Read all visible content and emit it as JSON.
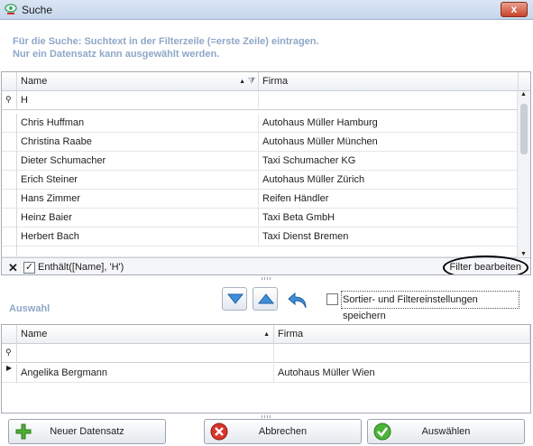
{
  "window": {
    "title": "Suche",
    "close_label": "x"
  },
  "hint": {
    "line1": "Für die Suche: Suchtext in der Filterzeile (=erste Zeile) eintragen.",
    "line2": "Nur ein Datensatz kann ausgewählt werden."
  },
  "grid1": {
    "columns": [
      "Name",
      "Firma"
    ],
    "filter_value": "H",
    "rows": [
      {
        "name": "Chris Huffman",
        "firma": "Autohaus Müller Hamburg"
      },
      {
        "name": "Christina Raabe",
        "firma": "Autohaus Müller München"
      },
      {
        "name": "Dieter Schumacher",
        "firma": "Taxi Schumacher KG"
      },
      {
        "name": "Erich Steiner",
        "firma": "Autohaus Müller Zürich"
      },
      {
        "name": "Hans Zimmer",
        "firma": "Reifen Händler"
      },
      {
        "name": "Heinz Baier",
        "firma": "Taxi Beta GmbH"
      },
      {
        "name": "Herbert Bach",
        "firma": "Taxi Dienst Bremen"
      }
    ],
    "filter_expression": "Enthält([Name], 'H')",
    "filter_edit_label": "Filter bearbeiten"
  },
  "auswahl_label": "Auswahl",
  "save_settings_label": "Sortier- und Filtereinstellungen speichern",
  "grid2": {
    "columns": [
      "Name",
      "Firma"
    ],
    "rows": [
      {
        "name": "Angelika Bergmann",
        "firma": "Autohaus Müller Wien"
      }
    ]
  },
  "buttons": {
    "new": "Neuer Datensatz",
    "cancel": "Abbrechen",
    "select": "Auswählen"
  },
  "icons": {
    "move_down": "arrow-down-icon",
    "move_up": "arrow-up-icon",
    "undo": "undo-icon"
  }
}
